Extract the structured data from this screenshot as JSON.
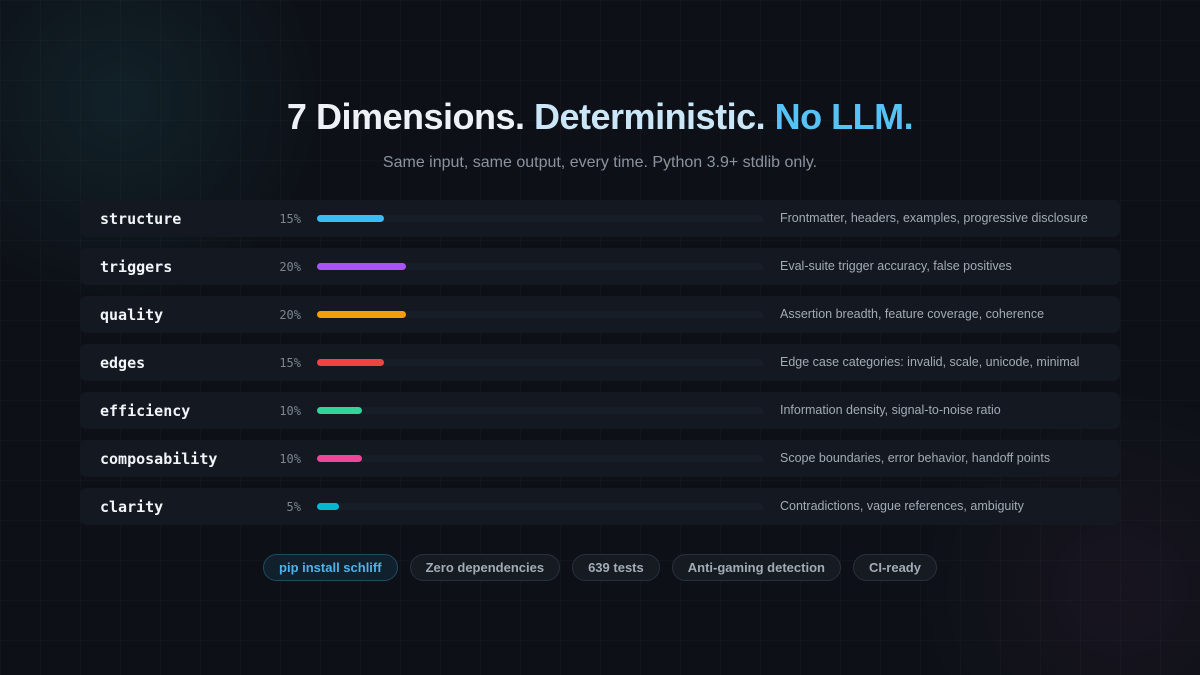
{
  "title": {
    "part1": "7 Dimensions.",
    "part2": "Deterministic.",
    "part3": "No LLM."
  },
  "subtitle": "Same input, same output, every time. Python 3.9+ stdlib only.",
  "dimensions": [
    {
      "name": "structure",
      "weight": "15%",
      "fraction": 0.15,
      "color": "#38bdf8",
      "description": "Frontmatter, headers, examples, progressive disclosure"
    },
    {
      "name": "triggers",
      "weight": "20%",
      "fraction": 0.2,
      "color": "#a855f7",
      "description": "Eval-suite trigger accuracy, false positives"
    },
    {
      "name": "quality",
      "weight": "20%",
      "fraction": 0.2,
      "color": "#f59e0b",
      "description": "Assertion breadth, feature coverage, coherence"
    },
    {
      "name": "edges",
      "weight": "15%",
      "fraction": 0.15,
      "color": "#ef4444",
      "description": "Edge case categories: invalid, scale, unicode, minimal"
    },
    {
      "name": "efficiency",
      "weight": "10%",
      "fraction": 0.1,
      "color": "#34d399",
      "description": "Information density, signal-to-noise ratio"
    },
    {
      "name": "composability",
      "weight": "10%",
      "fraction": 0.1,
      "color": "#ec4899",
      "description": "Scope boundaries, error behavior, handoff points"
    },
    {
      "name": "clarity",
      "weight": "5%",
      "fraction": 0.05,
      "color": "#06b6d4",
      "description": "Contradictions, vague references, ambiguity"
    }
  ],
  "pills": [
    "pip install schliff",
    "Zero dependencies",
    "639 tests",
    "Anti-gaming detection",
    "CI-ready"
  ]
}
